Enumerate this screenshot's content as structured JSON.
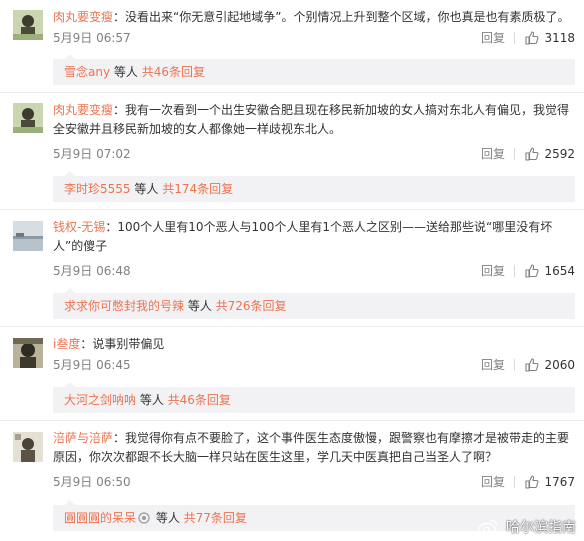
{
  "comments": [
    {
      "user": "肉丸要变瘦",
      "text": "：没看出来“你无意引起地域争”。个别情况上升到整个区域，你也真是也有素质极了。",
      "time": "5月9日 06:57",
      "reply_label": "回复",
      "likes": "3118",
      "replies": {
        "user": "雪念any",
        "mid": " 等人 ",
        "more": "共46条回复"
      }
    },
    {
      "user": "肉丸要变瘦",
      "text": "：我有一次看到一个出生安徽合肥且现在移民新加坡的女人搞对东北人有偏见，我觉得全安徽并且移民新加坡的女人都像她一样歧视东北人。",
      "time": "5月9日 07:02",
      "reply_label": "回复",
      "likes": "2592",
      "replies": {
        "user": "李时珍5555",
        "mid": " 等人 ",
        "more": "共174条回复"
      }
    },
    {
      "user": "钱权-无锡",
      "text": "：100个人里有10个恶人与100个人里有1个恶人之区别——送给那些说“哪里没有坏人”的傻子",
      "time": "5月9日 06:48",
      "reply_label": "回复",
      "likes": "1654",
      "replies": {
        "user": "求求你可憋封我的号辣",
        "mid": " 等人 ",
        "more": "共726条回复"
      }
    },
    {
      "user": "i叁度",
      "text": "：说事别带偏见",
      "time": "5月9日 06:45",
      "reply_label": "回复",
      "likes": "2060",
      "replies": {
        "user": "大河之剑呐呐",
        "mid": " 等人 ",
        "more": "共46条回复"
      }
    },
    {
      "user": "涪萨与涪萨",
      "text": "：我觉得你有点不要脸了，这个事件医生态度傲慢，跟警察也有摩擦才是被带走的主要原因，你次次都跟不长大脑一样只站在医生这里，学几天中医真把自己当圣人了啊？",
      "time": "5月9日 06:50",
      "reply_label": "回复",
      "likes": "1767",
      "replies": {
        "user": "圓圓圓的呆呆",
        "mid": " 等人 ",
        "more": "共77条回复"
      }
    }
  ],
  "watermark": {
    "text": "哈尔滨指南",
    "icon": "weibo-logo-icon"
  },
  "colors": {
    "accent": "#eb7350",
    "text": "#333333",
    "meta": "#808080",
    "reply_bg": "#f2f2f5"
  }
}
